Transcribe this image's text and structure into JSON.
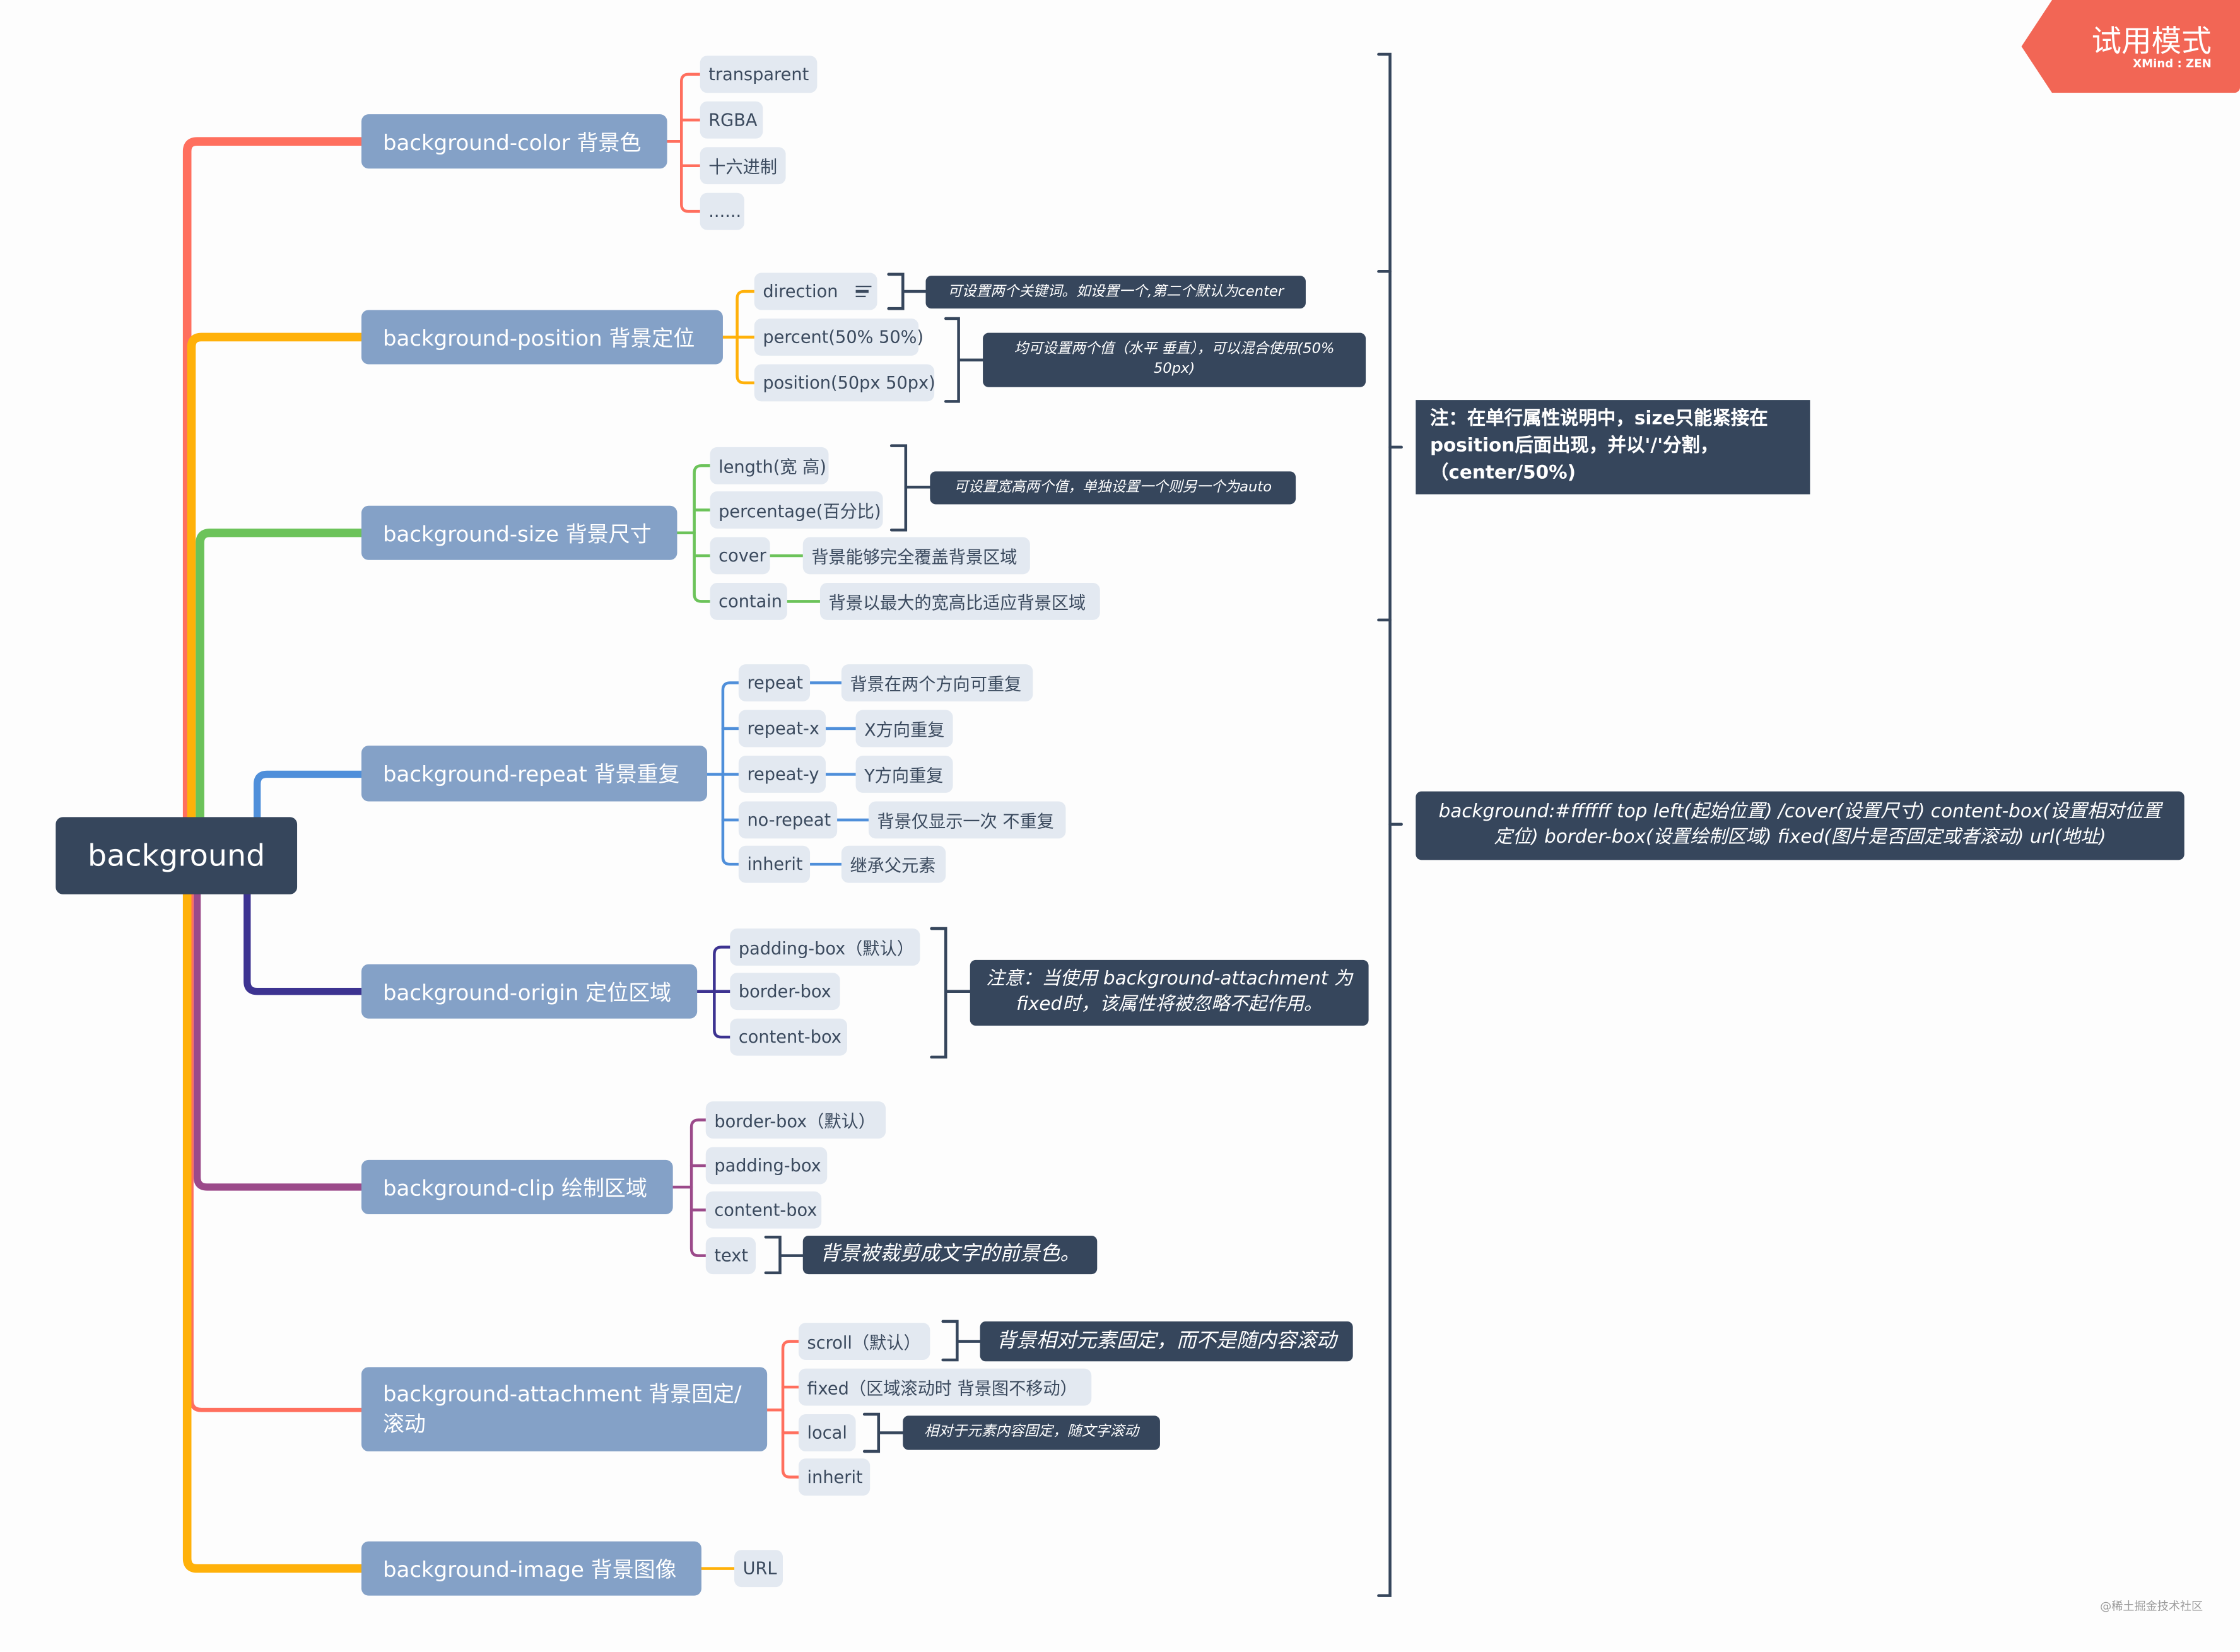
{
  "root": {
    "label": "background"
  },
  "colors": {
    "red": "#ff6f5e",
    "orange": "#ffb10a",
    "green": "#6cc35a",
    "blue": "#4f8fda",
    "indigo": "#3d3391",
    "purple": "#9b4a8a",
    "node_main": "#84a1c7",
    "node_sub": "#e3e9f1",
    "dark": "#36465c"
  },
  "branches": [
    {
      "label": "background-color 背景色",
      "children": [
        "transparent",
        "RGBA",
        "十六进制",
        "......"
      ]
    },
    {
      "label": "background-position 背景定位",
      "children": [
        "direction",
        "percent(50% 50%)",
        "position(50px 50px)"
      ],
      "notes": [
        "可设置两个关键词。如设置一个,第二个默认为center",
        "均可设置两个值（水平 垂直），可以混合使用(50% 50px)"
      ]
    },
    {
      "label": "background-size 背景尺寸",
      "children": [
        "length(宽 高)",
        "percentage(百分比)",
        "cover",
        "contain"
      ],
      "leaf": [
        "背景能够完全覆盖背景区域",
        "背景以最大的宽高比适应背景区域"
      ],
      "notes": [
        "可设置宽高两个值，单独设置一个则另一个为auto"
      ]
    },
    {
      "label": "background-repeat 背景重复",
      "children": [
        "repeat",
        "repeat-x",
        "repeat-y",
        "no-repeat",
        "inherit"
      ],
      "leaf": [
        "背景在两个方向可重复",
        "X方向重复",
        "Y方向重复",
        "背景仅显示一次 不重复",
        "继承父元素"
      ]
    },
    {
      "label": "background-origin 定位区域",
      "children": [
        "padding-box（默认）",
        "border-box",
        "content-box"
      ],
      "notes": [
        "注意：当使用 background-attachment 为 fixed时，该属性将被忽略不起作用。"
      ]
    },
    {
      "label": "background-clip 绘制区域",
      "children": [
        "border-box（默认）",
        "padding-box",
        "content-box",
        "text"
      ],
      "notes": [
        "背景被裁剪成文字的前景色。"
      ]
    },
    {
      "label": "background-attachment 背景固定/滚动",
      "children": [
        "scroll（默认）",
        "fixed（区域滚动时 背景图不移动）",
        "local",
        "inherit"
      ],
      "notes": [
        "背景相对元素固定，而不是随内容滚动",
        "相对于元素内容固定，随文字滚动"
      ]
    },
    {
      "label": "background-image 背景图像",
      "children": [
        "URL"
      ]
    }
  ],
  "summaries": [
    "注：在单行属性说明中，size只能紧接在position后面出现，并以'/'分割，（center/50%)",
    "background:#ffffff  top left(起始位置) /cover(设置尺寸) content-box(设置相对位置定位) border-box(设置绘制区域) fixed(图片是否固定或者滚动) url(地址)"
  ],
  "badge": {
    "title": "试用模式",
    "subtitle": "XMind : ZEN"
  },
  "watermark": "@稀土掘金技术社区",
  "icons": {
    "direction_note": "notes-icon"
  }
}
